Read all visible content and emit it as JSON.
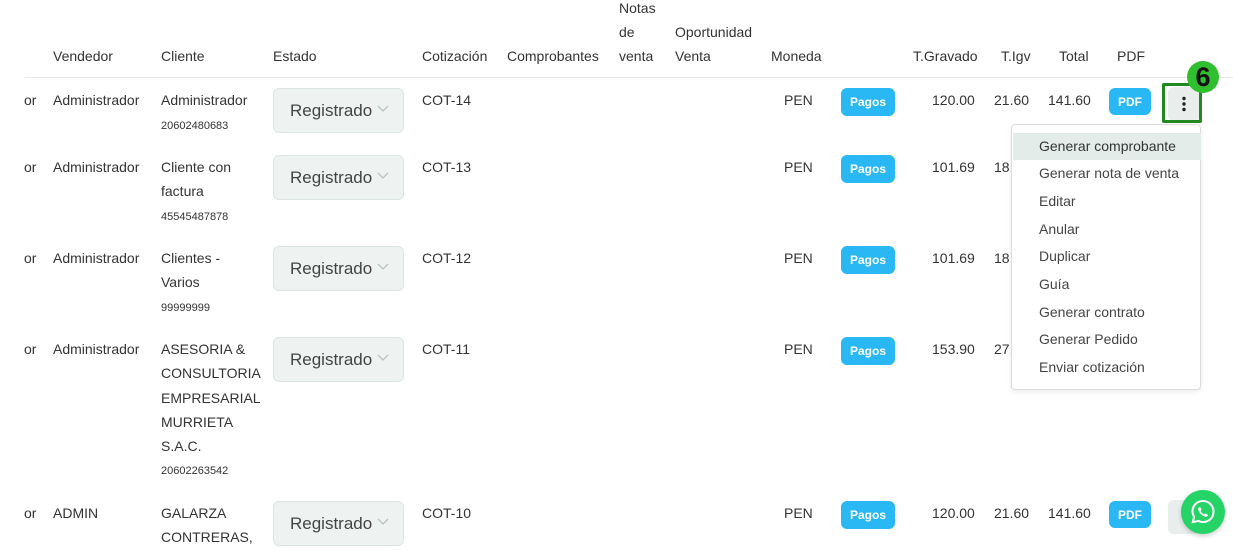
{
  "columns": {
    "vendedor": "Vendedor",
    "cliente": "Cliente",
    "estado": "Estado",
    "cotizacion": "Cotización",
    "comprobantes": "Comprobantes",
    "notas_line1": "Notas",
    "notas_line2": "de",
    "notas_line3": "venta",
    "oportunidad_line1": "Oportunidad",
    "oportunidad_line2": "Venta",
    "moneda": "Moneda",
    "tgravado": "T.Gravado",
    "tigv": "T.Igv",
    "total": "Total",
    "pdf": "PDF"
  },
  "rows": [
    {
      "cut": "or",
      "vendedor": "Administrador",
      "cliente_name": "Administrador",
      "cliente_doc": "20602480683",
      "estado": "Registrado",
      "cotizacion": "COT-14",
      "moneda": "PEN",
      "pagos": "Pagos",
      "tgravado": "120.00",
      "tigv": "21.60",
      "total": "141.60",
      "pdf": "PDF"
    },
    {
      "cut": "or",
      "vendedor": "Administrador",
      "cliente_name": "Cliente con factura",
      "cliente_doc": "45545487878",
      "estado": "Registrado",
      "cotizacion": "COT-13",
      "moneda": "PEN",
      "pagos": "Pagos",
      "tgravado": "101.69",
      "tigv": "18."
    },
    {
      "cut": "or",
      "vendedor": "Administrador",
      "cliente_name": "Clientes - Varios",
      "cliente_doc": "99999999",
      "estado": "Registrado",
      "cotizacion": "COT-12",
      "moneda": "PEN",
      "pagos": "Pagos",
      "tgravado": "101.69",
      "tigv": "18."
    },
    {
      "cut": "or",
      "vendedor": "Administrador",
      "cliente_name": "ASESORIA & CONSULTORIA EMPRESARIAL MURRIETA S.A.C.",
      "cliente_doc": "20602263542",
      "estado": "Registrado",
      "cotizacion": "COT-11",
      "moneda": "PEN",
      "pagos": "Pagos",
      "tgravado": "153.90",
      "tigv": "27."
    },
    {
      "cut": "or",
      "vendedor": "ADMIN",
      "cliente_name": "GALARZA CONTRERAS,",
      "estado": "Registrado",
      "cotizacion": "COT-10",
      "moneda": "PEN",
      "pagos": "Pagos",
      "tgravado": "120.00",
      "tigv": "21.60",
      "total": "141.60",
      "pdf": "PDF"
    }
  ],
  "step_badge": "6",
  "actions_menu": {
    "items": [
      "Generar comprobante",
      "Generar nota de venta",
      "Editar",
      "Anular",
      "Duplicar",
      "Guía",
      "Generar contrato",
      "Generar Pedido",
      "Enviar cotización"
    ],
    "highlighted_index": 0
  },
  "colors": {
    "accent_button": "#2ab8f5",
    "estado_bg": "#eef3f2",
    "highlight_border": "#1f8a1f",
    "whatsapp": "#25d366"
  },
  "icons": {
    "estado_dropdown": "chevron-down-icon",
    "row_actions": "kebab-menu-icon",
    "chat": "whatsapp-icon"
  }
}
